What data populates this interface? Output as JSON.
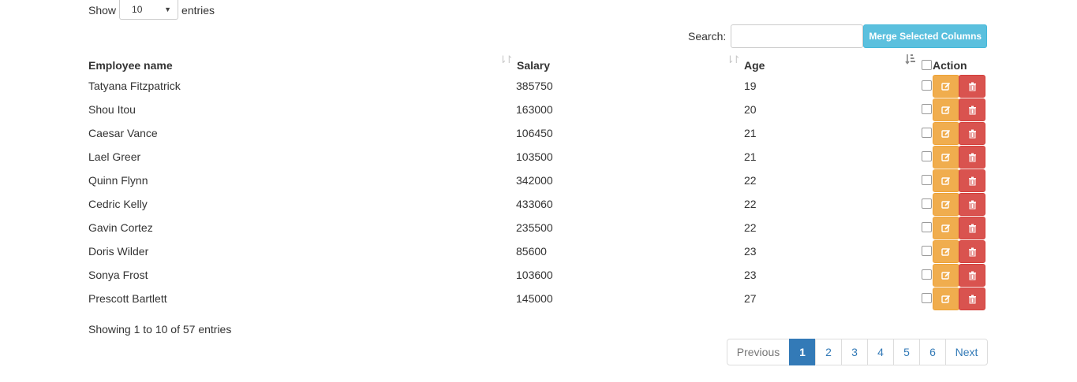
{
  "length_menu": {
    "show_label": "Show",
    "value": "10",
    "entries_label": "entries"
  },
  "search": {
    "label": "Search:",
    "value": "",
    "placeholder": ""
  },
  "merge_button": {
    "label": "Merge Selected Columns"
  },
  "table": {
    "columns": [
      {
        "label": "Employee name"
      },
      {
        "label": "Salary"
      },
      {
        "label": "Age"
      },
      {
        "label": "Action"
      }
    ],
    "sorted_column": "Age",
    "rows": [
      {
        "name": "Tatyana Fitzpatrick",
        "salary": "385750",
        "age": "19"
      },
      {
        "name": "Shou Itou",
        "salary": "163000",
        "age": "20"
      },
      {
        "name": "Caesar Vance",
        "salary": "106450",
        "age": "21"
      },
      {
        "name": "Lael Greer",
        "salary": "103500",
        "age": "21"
      },
      {
        "name": "Quinn Flynn",
        "salary": "342000",
        "age": "22"
      },
      {
        "name": "Cedric Kelly",
        "salary": "433060",
        "age": "22"
      },
      {
        "name": "Gavin Cortez",
        "salary": "235500",
        "age": "22"
      },
      {
        "name": "Doris Wilder",
        "salary": "85600",
        "age": "23"
      },
      {
        "name": "Sonya Frost",
        "salary": "103600",
        "age": "23"
      },
      {
        "name": "Prescott Bartlett",
        "salary": "145000",
        "age": "27"
      }
    ]
  },
  "info": {
    "text": "Showing 1 to 10 of 57 entries"
  },
  "pagination": {
    "previous": "Previous",
    "pages": [
      "1",
      "2",
      "3",
      "4",
      "5",
      "6"
    ],
    "active": "1",
    "next": "Next"
  },
  "colors": {
    "primary": "#337ab7",
    "info": "#5bc0de",
    "warning": "#f0ad4e",
    "danger": "#d9534f"
  },
  "icons": {
    "edit": "edit-icon",
    "delete": "trash-icon",
    "sort": "sort-icon",
    "sort_active": "sort-numeric-asc-icon"
  }
}
